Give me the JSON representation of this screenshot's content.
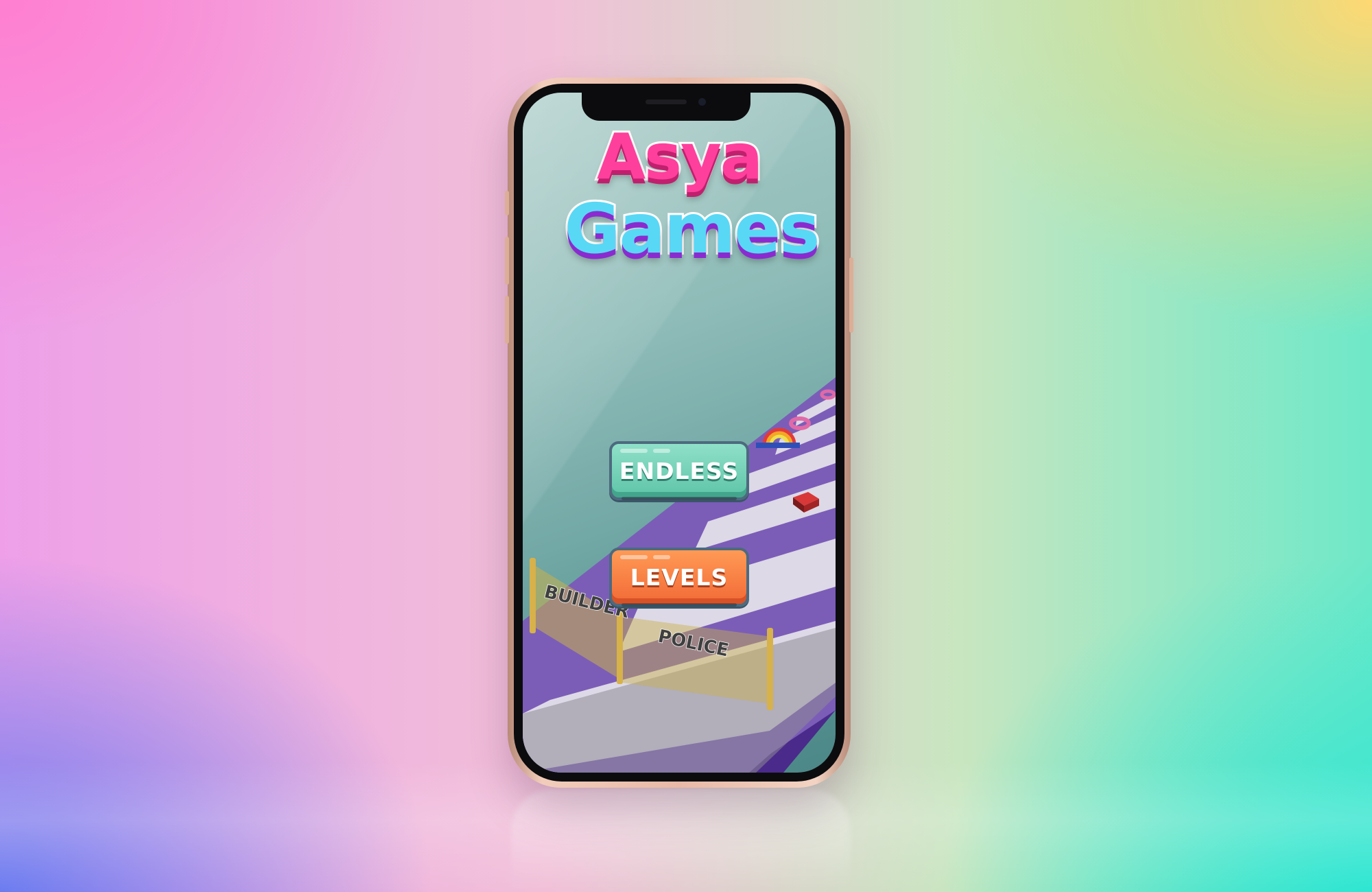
{
  "logo": {
    "line1": "Asya",
    "line2": "Games"
  },
  "menu": {
    "endless_label": "ENDLESS",
    "levels_label": "LEVELS"
  },
  "scene": {
    "gate_left_label": "BUILDER",
    "gate_right_label": "POLICE"
  },
  "colors": {
    "screen_bg": "#8fbcb8",
    "track_purple": "#7b5db8",
    "track_stripe": "#e8e6ec",
    "endless_button": "#5ec4a8",
    "levels_button": "#f26a37",
    "logo_pink": "#ff3f9c",
    "logo_cyan": "#58d8f5",
    "phone_frame": "#e8b9a6"
  }
}
